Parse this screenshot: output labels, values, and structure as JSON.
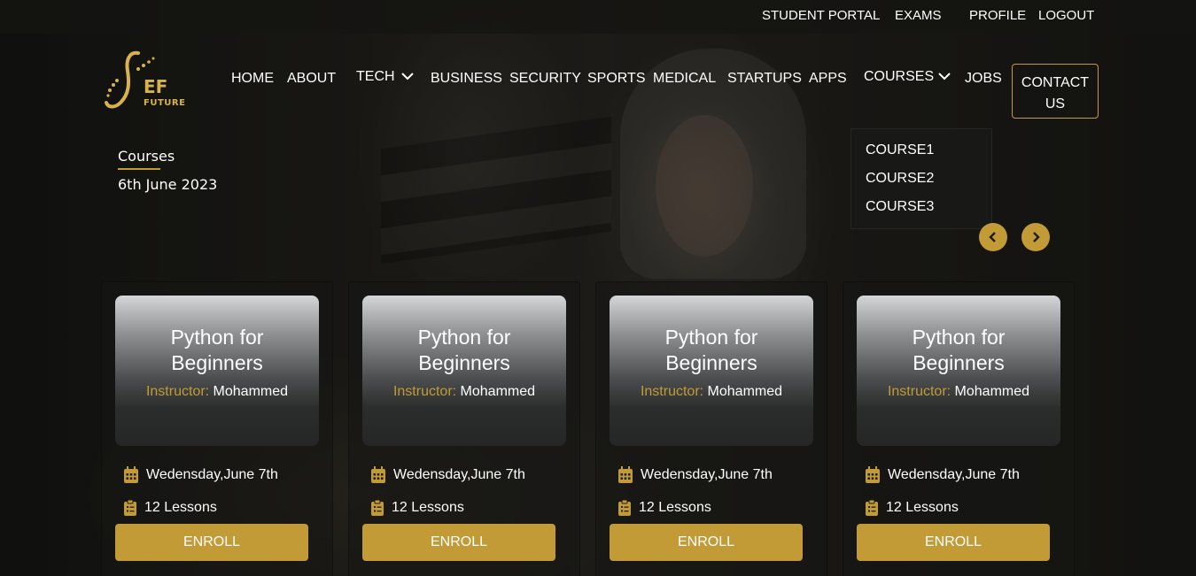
{
  "topbar": {
    "links": [
      "STUDENT PORTAL",
      "EXAMS",
      "PROFILE",
      "LOGOUT"
    ]
  },
  "logo": {
    "mark": "EF",
    "sub": "FUTURE"
  },
  "nav": {
    "home": "HOME",
    "about": "ABOUT",
    "tech": "TECH",
    "business": "BUSINESS",
    "security": "SECURITY",
    "sports": "SPORTS",
    "medical": "MEDICAL",
    "startups": "STARTUPS",
    "apps": "APPS",
    "courses": "COURSES",
    "jobs": "JOBS",
    "contact_line1": "CONTACT",
    "contact_line2": "US"
  },
  "courses_dropdown": {
    "options": [
      "COURSE1",
      "COURSE2",
      "COURSE3"
    ]
  },
  "breadcrumb": {
    "title": "Courses",
    "date": "6th June 2023"
  },
  "cards": [
    {
      "title_line1": "Python for",
      "title_line2": "Beginners",
      "instructor_label": "Instructor:",
      "instructor": "Mohammed",
      "date": "Wedensday,June 7th",
      "lessons": "12 Lessons",
      "button": "ENROLL"
    },
    {
      "title_line1": "Python for",
      "title_line2": "Beginners",
      "instructor_label": "Instructor:",
      "instructor": "Mohammed",
      "date": "Wedensday,June 7th",
      "lessons": "12 Lessons",
      "button": "ENROLL"
    },
    {
      "title_line1": "Python for",
      "title_line2": "Beginners",
      "instructor_label": "Instructor:",
      "instructor": "Mohammed",
      "date": "Wedensday,June 7th",
      "lessons": "12 Lessons",
      "button": "ENROLL"
    },
    {
      "title_line1": "Python for",
      "title_line2": "Beginners",
      "instructor_label": "Instructor:",
      "instructor": "Mohammed",
      "date": "Wedensday,June 7th",
      "lessons": "12 Lessons",
      "button": "ENROLL"
    }
  ],
  "colors": {
    "accent": "#c29b36",
    "background": "#1b1b18"
  },
  "icons": {
    "calendar": "calendar-icon",
    "clipboard": "clipboard-icon",
    "prev": "chevron-left-icon",
    "next": "chevron-right-icon",
    "dropdown": "chevron-down-icon"
  }
}
